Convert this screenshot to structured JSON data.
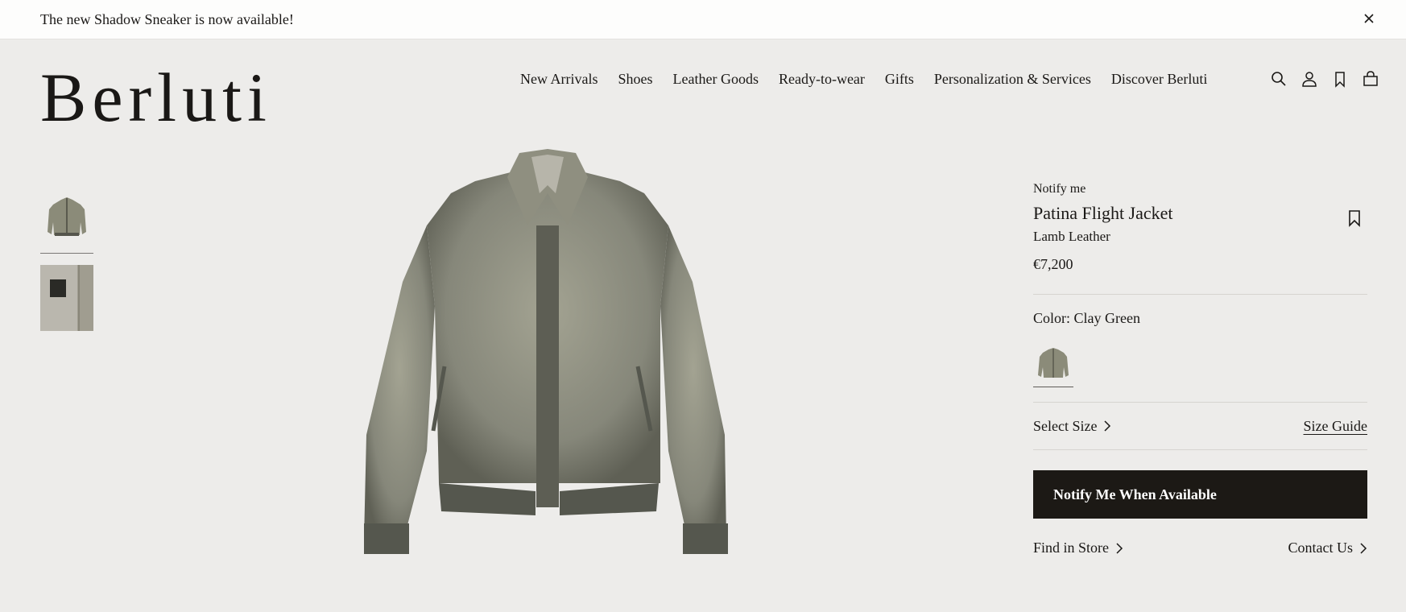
{
  "banner": {
    "text": "The new Shadow Sneaker is now available!",
    "close_icon": "close-icon"
  },
  "brand": {
    "logo": "Berluti"
  },
  "nav": {
    "items": [
      "New Arrivals",
      "Shoes",
      "Leather Goods",
      "Ready-to-wear",
      "Gifts",
      "Personalization & Services",
      "Discover Berluti"
    ]
  },
  "header_icons": [
    "search-icon",
    "account-icon",
    "bookmark-icon",
    "bag-icon"
  ],
  "product": {
    "status_label": "Notify me",
    "name": "Patina Flight Jacket",
    "material": "Lamb Leather",
    "price": "€7,200",
    "color_label": "Color: Clay Green",
    "select_size": "Select Size",
    "size_guide": "Size Guide",
    "cta": "Notify Me When Available",
    "find_in_store": "Find in Store",
    "contact_us": "Contact Us"
  },
  "colors": {
    "background": "#edecea",
    "cta": "#1c1915",
    "jacket": "#8b8b79"
  }
}
